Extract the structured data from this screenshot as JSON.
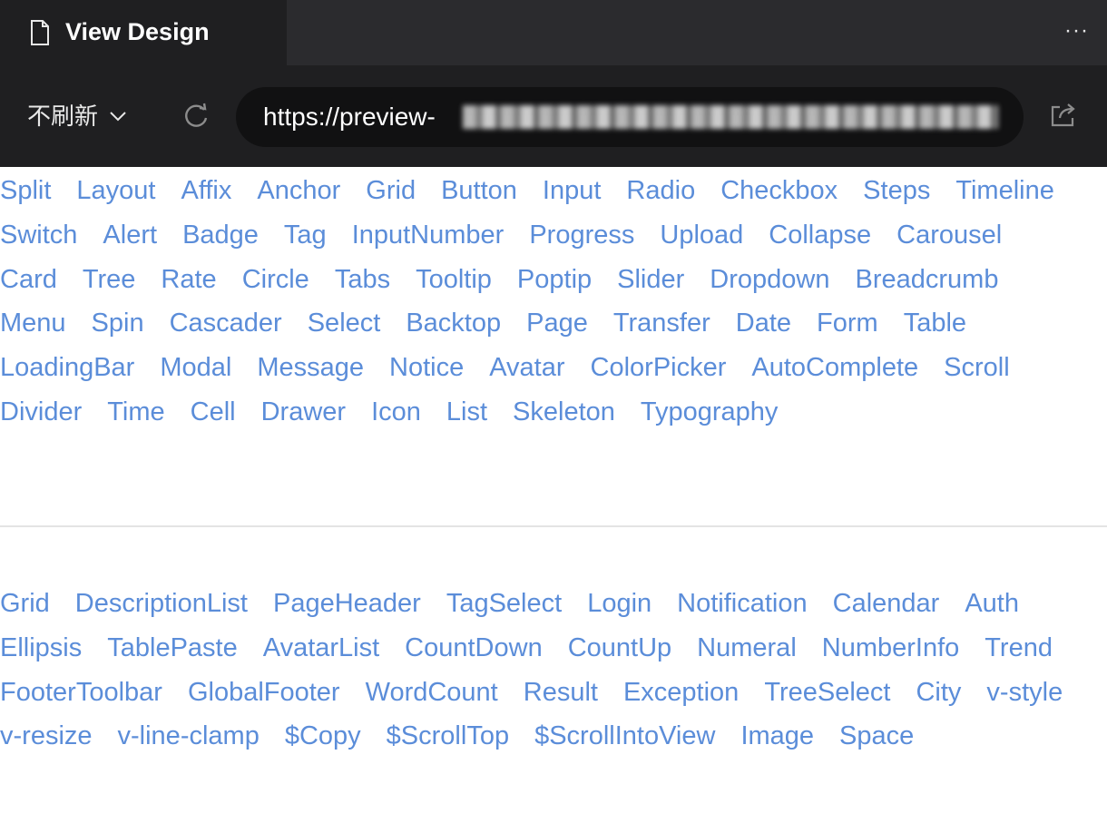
{
  "tab": {
    "title": "View Design",
    "icon": "file-icon"
  },
  "header": {
    "more_label": "···"
  },
  "toolbar": {
    "refresh_mode": "不刷新",
    "url_text": "https://preview-",
    "reload_icon": "reload-icon",
    "share_icon": "share-icon"
  },
  "colors": {
    "link": "#5b8dd9",
    "tabbar_bg": "#2b2b2e",
    "nav_bg": "#1f1f21",
    "url_bg": "#111112"
  },
  "components": [
    "Split",
    "Layout",
    "Affix",
    "Anchor",
    "Grid",
    "Button",
    "Input",
    "Radio",
    "Checkbox",
    "Steps",
    "Timeline",
    "Switch",
    "Alert",
    "Badge",
    "Tag",
    "InputNumber",
    "Progress",
    "Upload",
    "Collapse",
    "Carousel",
    "Card",
    "Tree",
    "Rate",
    "Circle",
    "Tabs",
    "Tooltip",
    "Poptip",
    "Slider",
    "Dropdown",
    "Breadcrumb",
    "Menu",
    "Spin",
    "Cascader",
    "Select",
    "Backtop",
    "Page",
    "Transfer",
    "Date",
    "Form",
    "Table",
    "LoadingBar",
    "Modal",
    "Message",
    "Notice",
    "Avatar",
    "ColorPicker",
    "AutoComplete",
    "Scroll",
    "Divider",
    "Time",
    "Cell",
    "Drawer",
    "Icon",
    "List",
    "Skeleton",
    "Typography"
  ],
  "pro_components": [
    "Grid",
    "DescriptionList",
    "PageHeader",
    "TagSelect",
    "Login",
    "Notification",
    "Calendar",
    "Auth",
    "Ellipsis",
    "TablePaste",
    "AvatarList",
    "CountDown",
    "CountUp",
    "Numeral",
    "NumberInfo",
    "Trend",
    "FooterToolbar",
    "GlobalFooter",
    "WordCount",
    "Result",
    "Exception",
    "TreeSelect",
    "City",
    "v-style",
    "v-resize",
    "v-line-clamp",
    "$Copy",
    "$ScrollTop",
    "$ScrollIntoView",
    "Image",
    "Space"
  ]
}
